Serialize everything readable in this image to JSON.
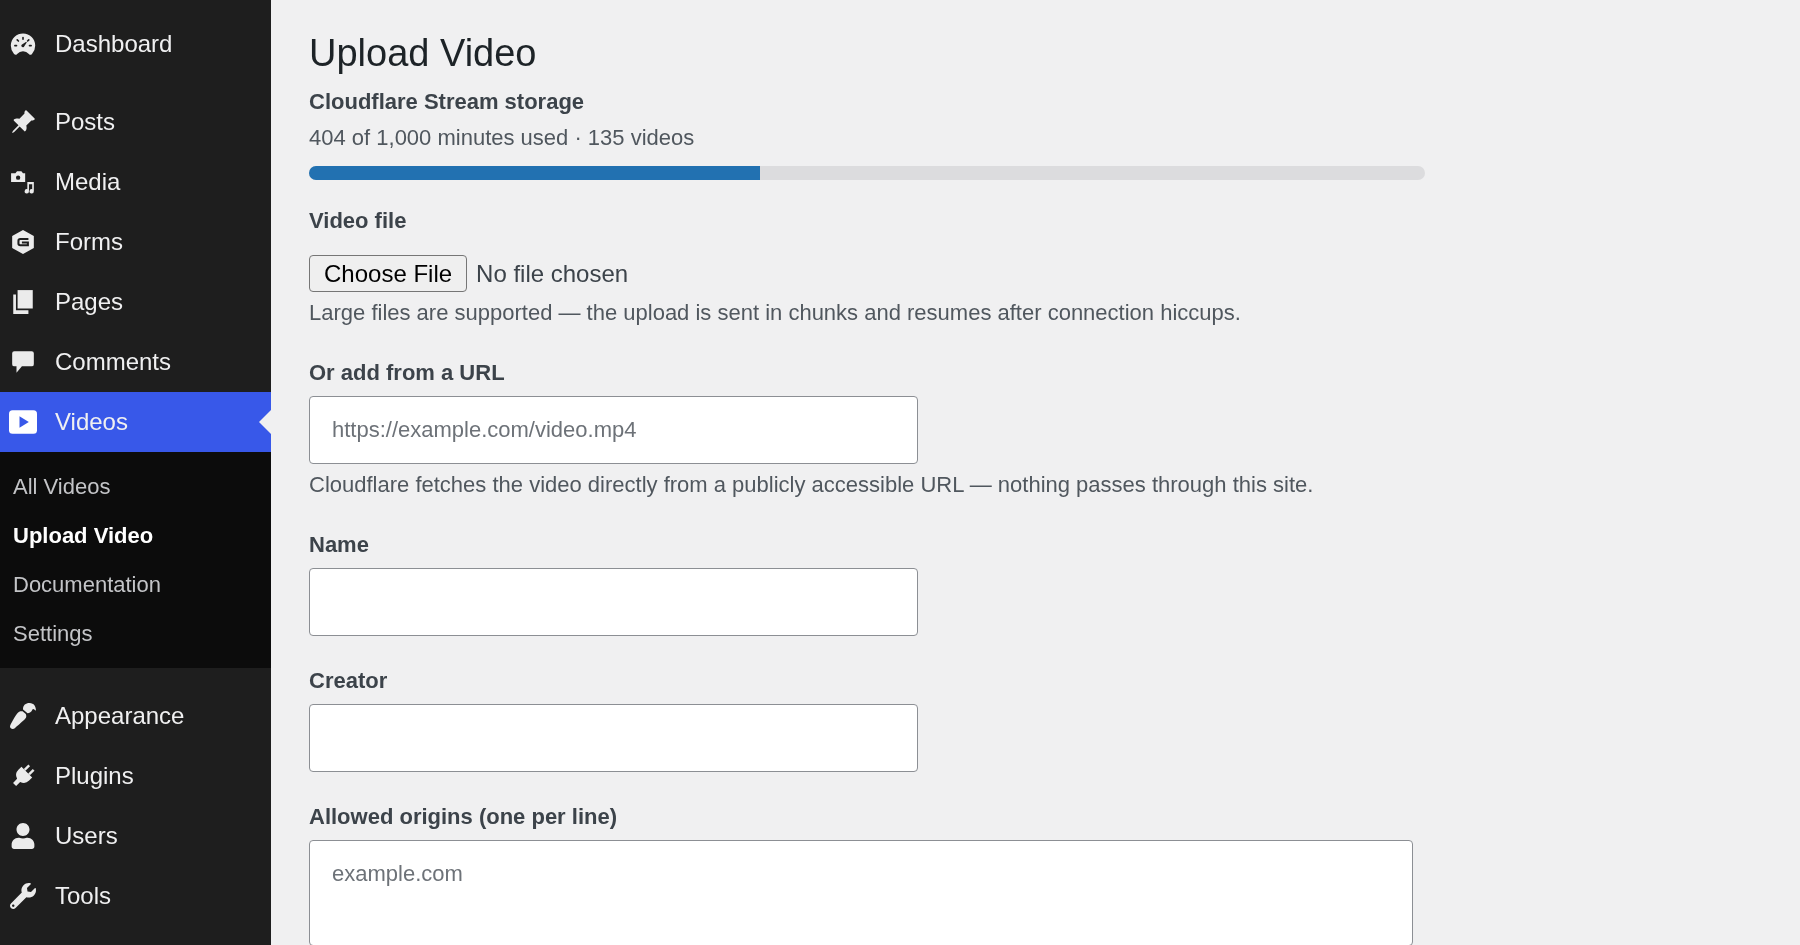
{
  "sidebar": {
    "groups": [
      {
        "items": [
          {
            "label": "Dashboard",
            "selected": false
          }
        ]
      },
      {
        "items": [
          {
            "label": "Posts",
            "selected": false
          },
          {
            "label": "Media",
            "selected": false
          },
          {
            "label": "Forms",
            "selected": false
          },
          {
            "label": "Pages",
            "selected": false
          },
          {
            "label": "Comments",
            "selected": false
          },
          {
            "label": "Videos",
            "selected": true,
            "submenu": [
              {
                "label": "All Videos",
                "selected": false
              },
              {
                "label": "Upload Video",
                "selected": true
              },
              {
                "label": "Documentation",
                "selected": false
              },
              {
                "label": "Settings",
                "selected": false
              }
            ]
          }
        ]
      },
      {
        "items": [
          {
            "label": "Appearance",
            "selected": false
          },
          {
            "label": "Plugins",
            "selected": false
          },
          {
            "label": "Users",
            "selected": false
          },
          {
            "label": "Tools",
            "selected": false
          }
        ]
      }
    ]
  },
  "page": {
    "title": "Upload Video"
  },
  "storage": {
    "heading": "Cloudflare Stream storage",
    "summary": "404 of 1,000 minutes used · 135 videos",
    "level": 0.404
  },
  "form": {
    "fields": [
      {
        "kind": "file",
        "label": "Video file",
        "button": "Choose File",
        "status": "No file chosen",
        "help": "Large files are supported — the upload is sent in chunks and resumes after connection hiccups."
      },
      {
        "kind": "text",
        "label": "Or add from a URL",
        "placeholder": "https://example.com/video.mp4",
        "help": "Cloudflare fetches the video directly from a publicly accessible URL — nothing passes through this site."
      },
      {
        "kind": "text",
        "label": "Name"
      },
      {
        "kind": "text",
        "label": "Creator"
      },
      {
        "kind": "textarea",
        "label": "Allowed origins (one per line)",
        "placeholder": "example.com"
      }
    ]
  }
}
